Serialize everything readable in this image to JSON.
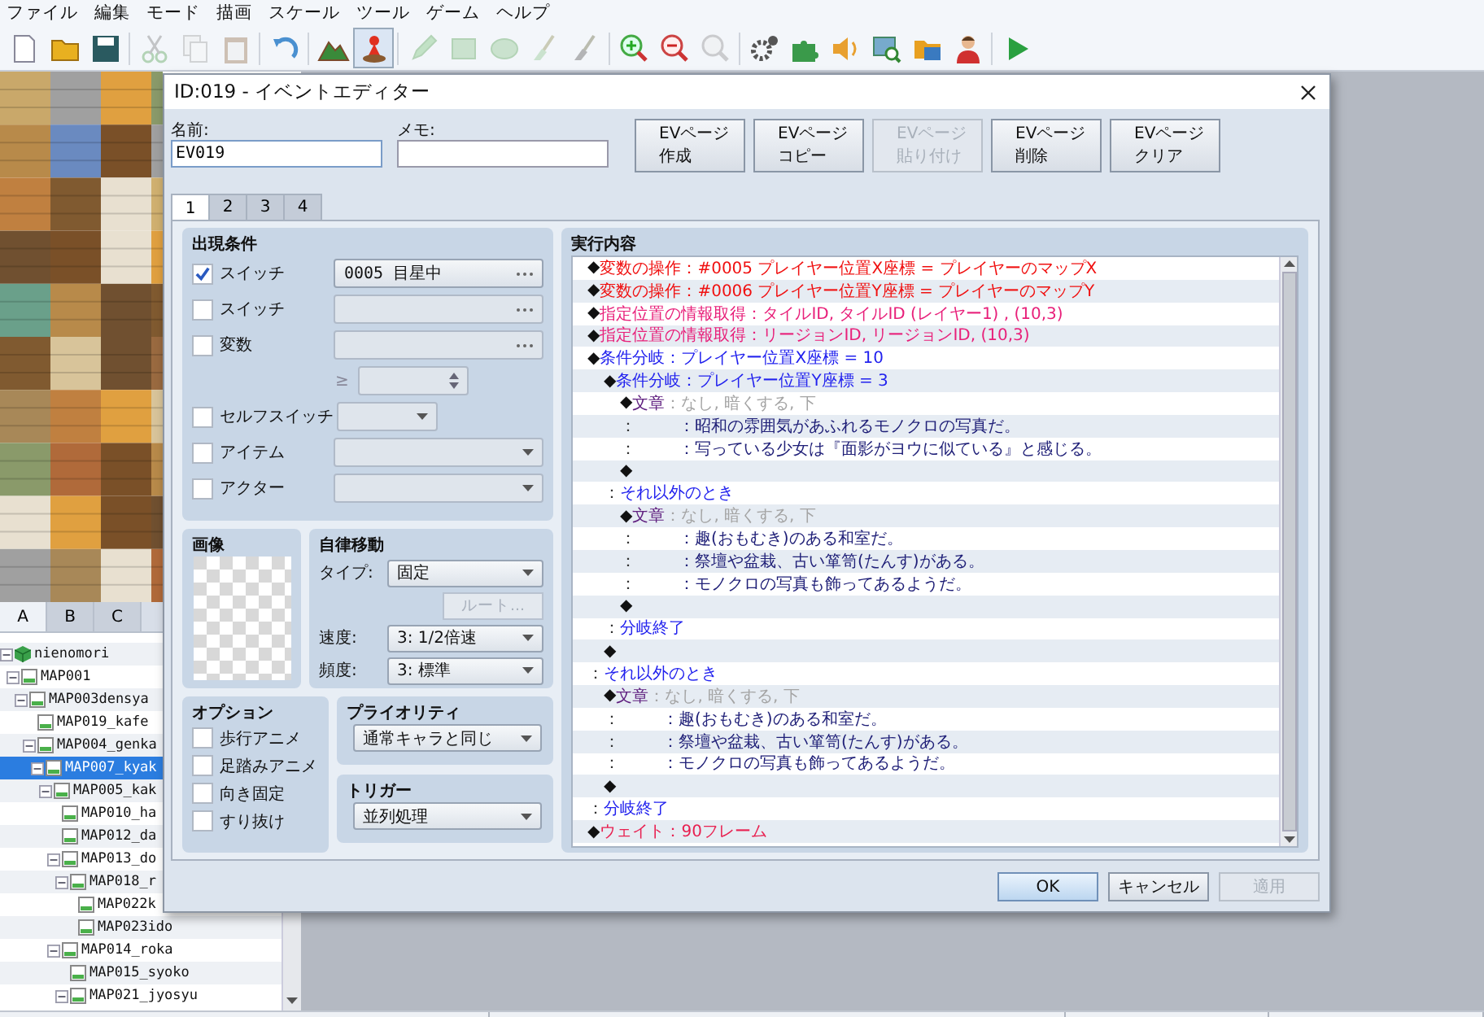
{
  "menu": [
    "ファイル",
    "編集",
    "モード",
    "描画",
    "スケール",
    "ツール",
    "ゲーム",
    "ヘルプ"
  ],
  "toolbar": [
    {
      "selected": false,
      "disabled": false
    },
    {
      "selected": false,
      "disabled": false
    },
    {
      "selected": false,
      "disabled": false
    },
    {
      "selected": false,
      "disabled": true
    },
    {
      "selected": false,
      "disabled": true
    },
    {
      "selected": false,
      "disabled": true
    },
    {
      "selected": false,
      "disabled": false
    },
    {
      "selected": false,
      "disabled": false
    },
    {
      "selected": true,
      "disabled": false
    },
    {
      "selected": false,
      "disabled": true
    },
    {
      "selected": false,
      "disabled": true
    },
    {
      "selected": false,
      "disabled": true
    },
    {
      "selected": false,
      "disabled": true
    },
    {
      "selected": false,
      "disabled": true
    },
    {
      "selected": false,
      "disabled": false
    },
    {
      "selected": false,
      "disabled": false
    },
    {
      "selected": false,
      "disabled": true
    },
    {
      "selected": false,
      "disabled": false
    },
    {
      "selected": false,
      "disabled": false
    },
    {
      "selected": false,
      "disabled": false
    },
    {
      "selected": false,
      "disabled": false
    },
    {
      "selected": false,
      "disabled": false
    },
    {
      "selected": false,
      "disabled": false
    },
    {
      "selected": false,
      "disabled": false
    }
  ],
  "tile_tabs": [
    {
      "label": "A",
      "selected": true
    },
    {
      "label": "B",
      "selected": false
    },
    {
      "label": "C",
      "selected": false
    }
  ],
  "map_tree": [
    {
      "label": "nienomori",
      "expanded": true,
      "selected": false,
      "kind": "project",
      "children": [
        {
          "label": "MAP001",
          "expanded": true,
          "selected": false,
          "children": [
            {
              "label": "MAP003densya",
              "expanded": true,
              "selected": false,
              "children": [
                {
                  "label": "MAP019_kafe",
                  "expanded": false,
                  "selected": false
                },
                {
                  "label": "MAP004_genka",
                  "expanded": true,
                  "selected": false,
                  "children": [
                    {
                      "label": "MAP007_kyak",
                      "expanded": true,
                      "selected": true,
                      "children": [
                        {
                          "label": "MAP005_kak",
                          "expanded": true,
                          "selected": false,
                          "children": [
                            {
                              "label": "MAP010_ha",
                              "expanded": false,
                              "selected": false
                            },
                            {
                              "label": "MAP012_da",
                              "expanded": false,
                              "selected": false
                            },
                            {
                              "label": "MAP013_do",
                              "expanded": true,
                              "selected": false,
                              "children": [
                                {
                                  "label": "MAP018_r",
                                  "expanded": true,
                                  "selected": false,
                                  "children": [
                                    {
                                      "label": "MAP022k",
                                      "expanded": false,
                                      "selected": false
                                    },
                                    {
                                      "label": "MAP023ido",
                                      "expanded": false,
                                      "selected": false
                                    }
                                  ]
                                }
                              ]
                            },
                            {
                              "label": "MAP014_roka",
                              "expanded": true,
                              "selected": false,
                              "children": [
                                {
                                  "label": "MAP015_syoko",
                                  "expanded": false,
                                  "selected": false
                                },
                                {
                                  "label": "MAP021_jyosyu",
                                  "expanded": true,
                                  "selected": false
                                }
                              ]
                            }
                          ]
                        }
                      ]
                    }
                  ]
                }
              ]
            }
          ]
        }
      ]
    }
  ],
  "dialog": {
    "title": "ID:019 - イベントエディター",
    "name": {
      "label": "名前:",
      "value": "EV019"
    },
    "memo": {
      "label": "メモ:"
    },
    "page_buttons": [
      {
        "lines": [
          "EVページ",
          "作成"
        ],
        "disabled": false
      },
      {
        "lines": [
          "EVページ",
          "コピー"
        ],
        "disabled": false
      },
      {
        "lines": [
          "EVページ",
          "貼り付け"
        ],
        "disabled": true
      },
      {
        "lines": [
          "EVページ",
          "削除"
        ],
        "disabled": false
      },
      {
        "lines": [
          "EVページ",
          "クリア"
        ],
        "disabled": false
      }
    ],
    "page_tabs": [
      {
        "label": "1",
        "selected": true
      },
      {
        "label": "2",
        "selected": false
      },
      {
        "label": "3",
        "selected": false
      },
      {
        "label": "4",
        "selected": false
      }
    ],
    "conditions": {
      "title": "出現条件",
      "items": [
        {
          "kind": "switch",
          "label": "スイッチ",
          "checked": true,
          "value": "0005 目星中"
        },
        {
          "kind": "switch",
          "label": "スイッチ",
          "checked": false
        },
        {
          "kind": "variable",
          "label": "変数",
          "checked": false,
          "operator": "≥"
        },
        {
          "kind": "self_switch",
          "label": "セルフスイッチ",
          "checked": false
        },
        {
          "kind": "item",
          "label": "アイテム",
          "checked": false
        },
        {
          "kind": "actor",
          "label": "アクター",
          "checked": false
        }
      ]
    },
    "image": {
      "title": "画像"
    },
    "movement": {
      "title": "自律移動",
      "type": {
        "label": "タイプ:",
        "value": "固定"
      },
      "route_button": {
        "label": "ルート...",
        "disabled": true
      },
      "speed": {
        "label": "速度:",
        "value": "3: 1/2倍速"
      },
      "frequency": {
        "label": "頻度:",
        "value": "3: 標準"
      }
    },
    "options": {
      "title": "オプション",
      "items": [
        {
          "label": "歩行アニメ",
          "checked": false
        },
        {
          "label": "足踏みアニメ",
          "checked": false
        },
        {
          "label": "向き固定",
          "checked": false
        },
        {
          "label": "すり抜け",
          "checked": false
        }
      ]
    },
    "priority": {
      "title": "プライオリティ",
      "value": "通常キャラと同じ"
    },
    "trigger": {
      "title": "トリガー",
      "value": "並列処理"
    },
    "contents": {
      "title": "実行内容",
      "commands": [
        {
          "kind": "variable",
          "prefix": "◆",
          "name": "変数の操作：#0005 プレイヤー位置X座標 = プレイヤーのマップX"
        },
        {
          "kind": "variable",
          "prefix": "◆",
          "name": "変数の操作：#0006 プレイヤー位置Y座標 = プレイヤーのマップY"
        },
        {
          "kind": "info",
          "prefix": "◆",
          "name": "指定位置の情報取得：タイルID, タイルID (レイヤー1) , (10,3)"
        },
        {
          "kind": "info",
          "prefix": "◆",
          "name": "指定位置の情報取得：リージョンID, リージョンID, (10,3)"
        },
        {
          "kind": "branch",
          "prefix": "◆",
          "name": "条件分岐：プレイヤー位置X座標 = 10",
          "children": [
            {
              "kind": "branch",
              "prefix": "◆",
              "name": "条件分岐：プレイヤー位置Y座標 = 3",
              "children": [
                {
                  "kind": "message",
                  "prefix": "◆",
                  "name": "文章",
                  "params": "：なし, 暗くする, 下",
                  "lines": [
                    {
                      "prefix": "：",
                      "text": "：昭和の雰囲気があふれるモノクロの写真だ。"
                    },
                    {
                      "prefix": "：",
                      "text": "：写っている少女は『面影がヨウに似ている』と感じる。"
                    }
                  ]
                },
                {
                  "kind": "empty",
                  "prefix": "◆"
                }
              ]
            },
            {
              "kind": "else",
              "prefix": "：",
              "name": "それ以外のとき",
              "children": [
                {
                  "kind": "message",
                  "prefix": "◆",
                  "name": "文章",
                  "params": "：なし, 暗くする, 下",
                  "lines": [
                    {
                      "prefix": "：",
                      "text": "：趣(おもむき)のある和室だ。"
                    },
                    {
                      "prefix": "：",
                      "text": "：祭壇や盆栽、古い箪笥(たんす)がある。"
                    },
                    {
                      "prefix": "：",
                      "text": "：モノクロの写真も飾ってあるようだ。"
                    }
                  ]
                },
                {
                  "kind": "empty",
                  "prefix": "◆"
                }
              ]
            },
            {
              "kind": "end",
              "prefix": "：",
              "name": "分岐終了"
            },
            {
              "kind": "empty",
              "prefix": "◆"
            }
          ]
        },
        {
          "kind": "else",
          "prefix": "：",
          "name": "それ以外のとき",
          "children": [
            {
              "kind": "message",
              "prefix": "◆",
              "name": "文章",
              "params": "：なし, 暗くする, 下",
              "lines": [
                {
                  "prefix": "：",
                  "text": "：趣(おもむき)のある和室だ。"
                },
                {
                  "prefix": "：",
                  "text": "：祭壇や盆栽、古い箪笥(たんす)がある。"
                },
                {
                  "prefix": "：",
                  "text": "：モノクロの写真も飾ってあるようだ。"
                }
              ]
            },
            {
              "kind": "empty",
              "prefix": "◆"
            }
          ]
        },
        {
          "kind": "end",
          "prefix": "：",
          "name": "分岐終了"
        },
        {
          "kind": "wait",
          "prefix": "◆",
          "name": "ウェイト：90フレーム"
        }
      ]
    },
    "buttons": [
      {
        "label": "OK",
        "default": true,
        "disabled": false
      },
      {
        "label": "キャンセル",
        "default": false,
        "disabled": false
      },
      {
        "label": "適用",
        "default": false,
        "disabled": true
      }
    ]
  }
}
